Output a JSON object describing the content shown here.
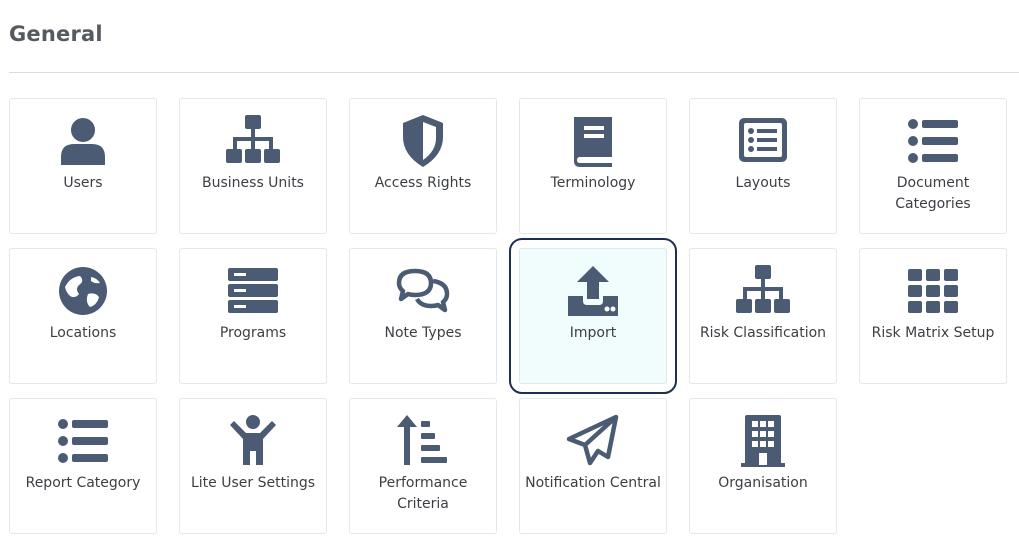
{
  "section": {
    "title": "General"
  },
  "theme": {
    "icon_color": "#4a5b73",
    "selected_border": "#1e2f55",
    "selected_bg": "#f1fcfd"
  },
  "tiles": [
    {
      "label": "Users",
      "icon": "user-icon"
    },
    {
      "label": "Business Units",
      "icon": "sitemap-icon"
    },
    {
      "label": "Access Rights",
      "icon": "shield-icon"
    },
    {
      "label": "Terminology",
      "icon": "book-icon"
    },
    {
      "label": "Layouts",
      "icon": "list-alt-icon"
    },
    {
      "label": "Document Categories",
      "icon": "list-icon"
    },
    {
      "label": "Locations",
      "icon": "globe-icon"
    },
    {
      "label": "Programs",
      "icon": "server-icon"
    },
    {
      "label": "Note Types",
      "icon": "comments-icon"
    },
    {
      "label": "Import",
      "icon": "upload-icon",
      "selected": true
    },
    {
      "label": "Risk Classification",
      "icon": "sitemap-icon"
    },
    {
      "label": "Risk Matrix Setup",
      "icon": "grid-icon"
    },
    {
      "label": "Report Category",
      "icon": "list-icon"
    },
    {
      "label": "Lite User Settings",
      "icon": "child-icon"
    },
    {
      "label": "Performance Criteria",
      "icon": "sort-amount-up-icon"
    },
    {
      "label": "Notification Central",
      "icon": "paper-plane-icon"
    },
    {
      "label": "Organisation",
      "icon": "building-icon"
    }
  ]
}
